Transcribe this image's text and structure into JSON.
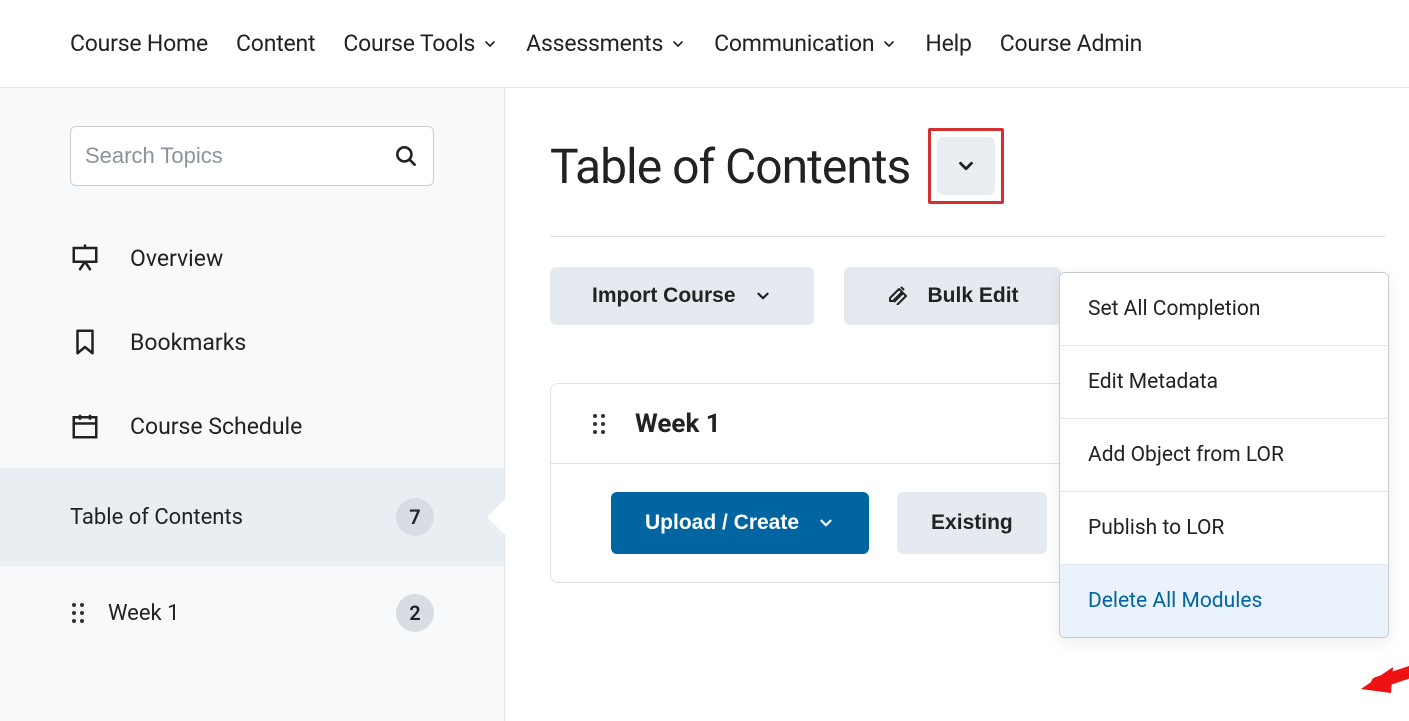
{
  "nav": {
    "course_home": "Course Home",
    "content": "Content",
    "course_tools": "Course Tools",
    "assessments": "Assessments",
    "communication": "Communication",
    "help": "Help",
    "course_admin": "Course Admin"
  },
  "sidebar": {
    "search_placeholder": "Search Topics",
    "overview": "Overview",
    "bookmarks": "Bookmarks",
    "course_schedule": "Course Schedule",
    "toc_label": "Table of Contents",
    "toc_count": "7",
    "modules": [
      {
        "label": "Week 1",
        "count": "2"
      }
    ]
  },
  "main": {
    "title": "Table of Contents",
    "import_course": "Import Course",
    "bulk_edit": "Bulk Edit",
    "module_title": "Week 1",
    "upload_create": "Upload / Create",
    "existing": "Existing"
  },
  "dropdown": {
    "set_completion": "Set All Completion",
    "edit_metadata": "Edit Metadata",
    "add_lor": "Add Object from LOR",
    "publish_lor": "Publish to LOR",
    "delete_all": "Delete All Modules"
  }
}
